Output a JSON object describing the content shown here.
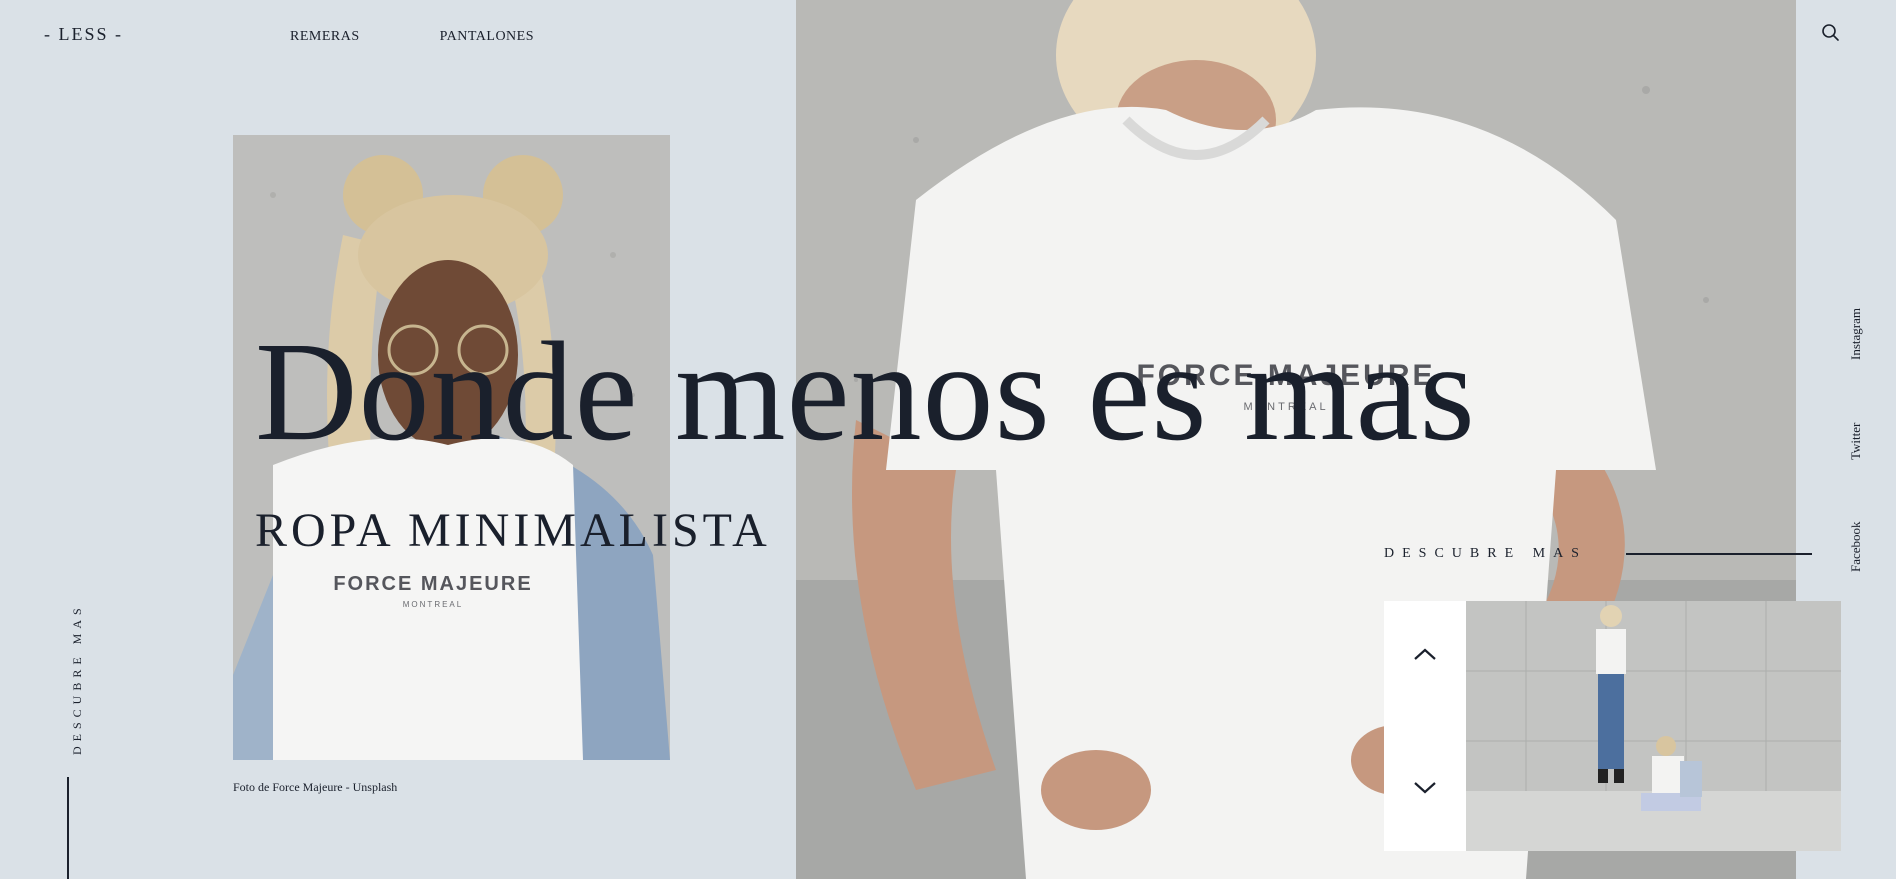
{
  "brand": {
    "logo": "- LESS -"
  },
  "nav": {
    "items": [
      "REMERAS",
      "PANTALONES"
    ]
  },
  "hero": {
    "headline": "Donde menos es mas",
    "subheadline": "ROPA MINIMALISTA",
    "photo_caption": "Foto de Force Majeure - Unsplash",
    "shirt_text": "FORCE MAJEURE",
    "shirt_subtext": "MONTREAL"
  },
  "side": {
    "discover_vertical": "DESCUBRE MAS"
  },
  "cta": {
    "discover": "DESCUBRE MAS"
  },
  "social": {
    "instagram": "Instagram",
    "twitter": "Twitter",
    "facebook": "Facebook"
  },
  "icons": {
    "search": "search-icon",
    "up": "chevron-up-icon",
    "down": "chevron-down-icon"
  },
  "colors": {
    "background": "#dae1e7",
    "text": "#1a202c",
    "slider_panel": "#ffffff"
  }
}
